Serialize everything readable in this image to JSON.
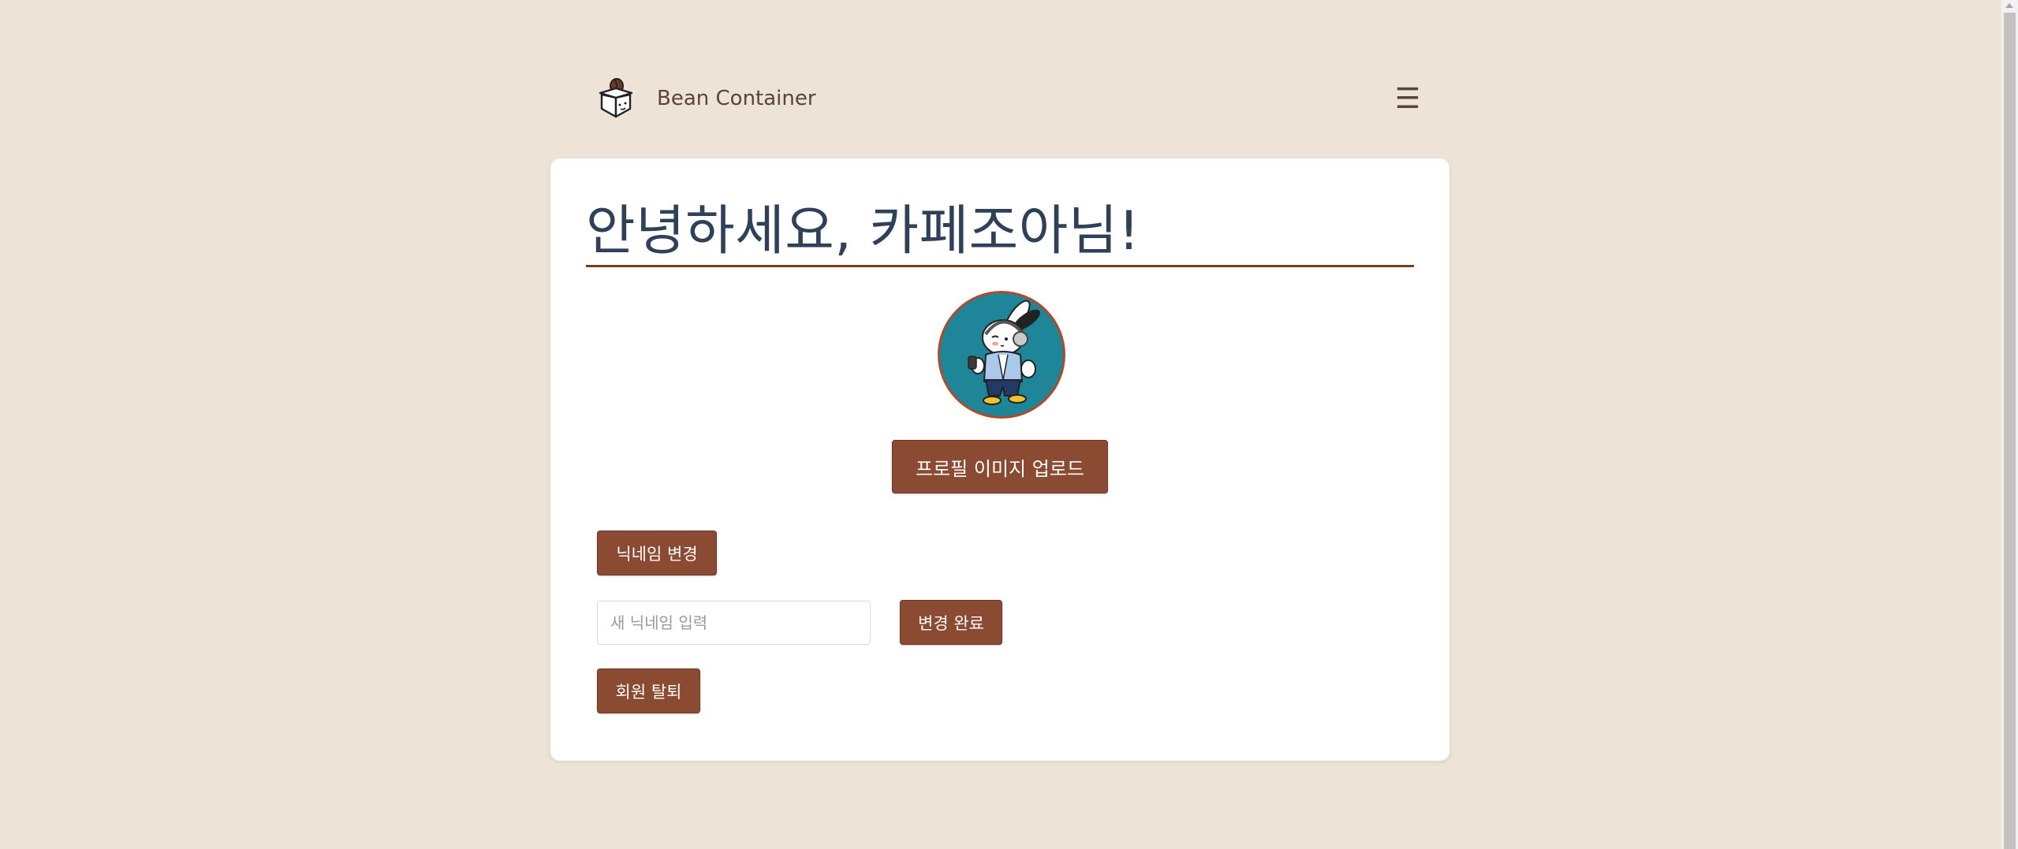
{
  "header": {
    "brand": "Bean Container",
    "logo_icon": "coffee-bean-box-logo",
    "menu_icon": "hamburger-menu-icon",
    "menu_glyph": "☰"
  },
  "profile": {
    "greeting": "안녕하세요, 카페조아님!",
    "avatar_icon": "rabbit-character-avatar",
    "upload_button": "프로필 이미지 업로드",
    "change_nickname_button": "닉네임 변경",
    "nickname_input": {
      "value": "",
      "placeholder": "새 닉네임 입력"
    },
    "confirm_button": "변경 완료",
    "withdraw_button": "회원 탈퇴"
  },
  "colors": {
    "background": "#ede3d6",
    "accent": "#8b4a32",
    "heading": "#2f4159",
    "divider": "#7a3a22",
    "avatar_bg": "#1f8599"
  }
}
